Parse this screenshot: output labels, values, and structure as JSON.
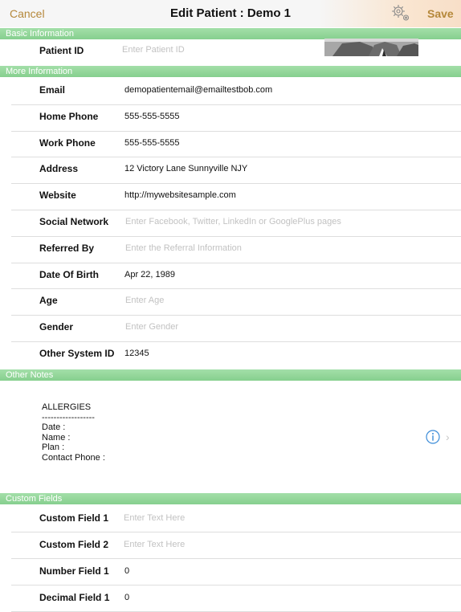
{
  "nav": {
    "cancel": "Cancel",
    "title": "Edit Patient : Demo 1",
    "save": "Save"
  },
  "sections": {
    "basic": "Basic Information",
    "more": "More Information",
    "notes": "Other Notes",
    "custom": "Custom Fields"
  },
  "basic": {
    "patient_id_label": "Patient ID",
    "patient_id_placeholder": "Enter Patient ID"
  },
  "more": [
    {
      "label": "Email",
      "value": "demopatientemail@emailtestbob.com",
      "placeholder": ""
    },
    {
      "label": "Home Phone",
      "value": "555-555-5555",
      "placeholder": ""
    },
    {
      "label": "Work Phone",
      "value": "555-555-5555",
      "placeholder": ""
    },
    {
      "label": "Address",
      "value": "12 Victory Lane Sunnyville NJY",
      "placeholder": ""
    },
    {
      "label": "Website",
      "value": "http://mywebsitesample.com",
      "placeholder": ""
    },
    {
      "label": "Social Network",
      "value": "",
      "placeholder": "Enter Facebook, Twitter, LinkedIn or GooglePlus pages"
    },
    {
      "label": "Referred By",
      "value": "",
      "placeholder": "Enter the Referral Information"
    },
    {
      "label": "Date Of Birth",
      "value": "Apr 22, 1989",
      "placeholder": ""
    },
    {
      "label": "Age",
      "value": "",
      "placeholder": "Enter Age"
    },
    {
      "label": "Gender",
      "value": "",
      "placeholder": "Enter Gender"
    },
    {
      "label": "Other System ID",
      "value": "12345",
      "placeholder": ""
    }
  ],
  "notes": {
    "lines": [
      "ALLERGIES",
      "------------------",
      "Date :",
      "Name :",
      "Plan :",
      "Contact Phone :"
    ]
  },
  "custom": [
    {
      "label": "Custom Field 1",
      "value": "",
      "placeholder": "Enter Text Here"
    },
    {
      "label": "Custom Field 2",
      "value": "",
      "placeholder": "Enter Text Here"
    },
    {
      "label": "Number Field 1",
      "value": "0",
      "placeholder": ""
    },
    {
      "label": "Decimal Field 1",
      "value": "0",
      "placeholder": ""
    }
  ],
  "colors": {
    "accent": "#b5883a",
    "section_green": "#8fd497",
    "info_blue": "#3a8bd8"
  }
}
